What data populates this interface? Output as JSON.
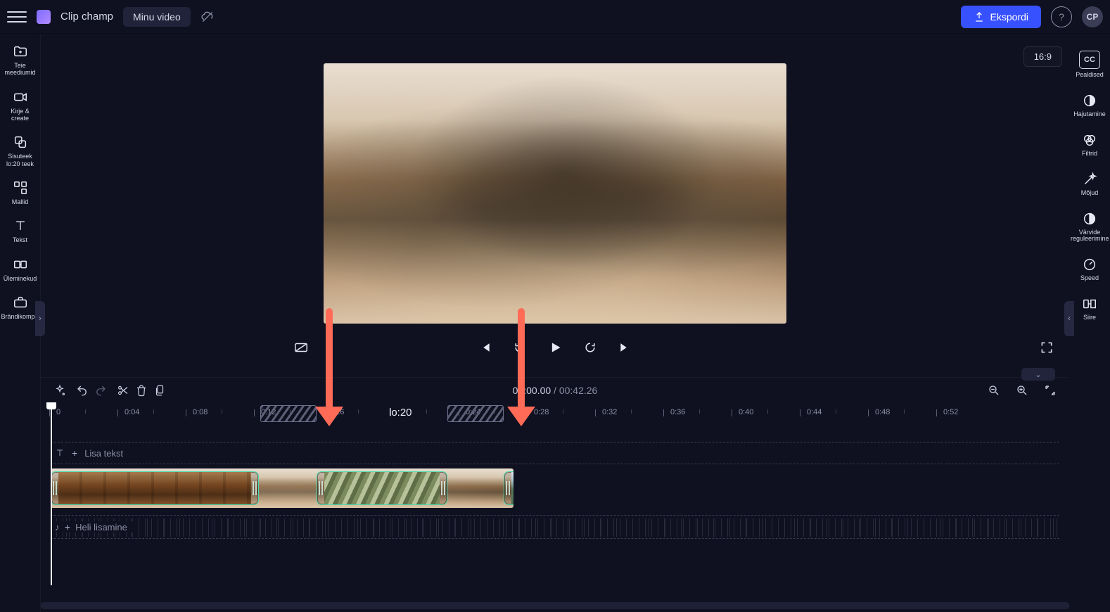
{
  "header": {
    "app_name": "Clip champ",
    "project_title": "Minu video",
    "export_label": "Ekspordi",
    "avatar_initials": "CP"
  },
  "leftbar": {
    "items": [
      {
        "id": "media",
        "label": "Teie meediumid"
      },
      {
        "id": "record",
        "label": "Kirje &amp; create"
      },
      {
        "id": "library",
        "label": "Sisuteek lo:20 teek"
      },
      {
        "id": "templates",
        "label": "Mallid"
      },
      {
        "id": "text",
        "label": "Tekst"
      },
      {
        "id": "transitions",
        "label": "Üleminekud"
      },
      {
        "id": "brand",
        "label": "Brändikomplekt"
      }
    ]
  },
  "rightbar": {
    "items": [
      {
        "id": "captions",
        "label": "Pealdised"
      },
      {
        "id": "fade",
        "label": "Hajutamine"
      },
      {
        "id": "filters",
        "label": "Filtrid"
      },
      {
        "id": "effects",
        "label": "Mõjud"
      },
      {
        "id": "colors",
        "label": "Värvide reguleerimine"
      },
      {
        "id": "speed",
        "label": "Speed"
      },
      {
        "id": "transition",
        "label": "Siire"
      }
    ]
  },
  "preview": {
    "aspect_label": "16:9"
  },
  "timeline": {
    "current_time": "00:00.00",
    "duration": "00:42.26",
    "center_label": "lo:20",
    "ruler": [
      "0",
      "0:04",
      "0:08",
      "0:12",
      "0:16",
      "",
      "0:24",
      "0:28",
      "0:32",
      "0:36",
      "0:40",
      "0:44",
      "0:48",
      "0:52"
    ],
    "text_track_label": "Lisa tekst",
    "audio_track_label": "Heli lisamine"
  }
}
